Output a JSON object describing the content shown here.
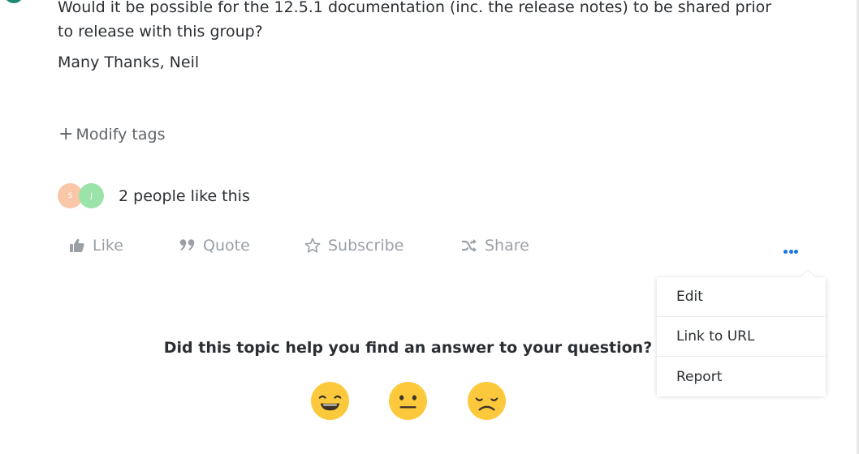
{
  "post": {
    "body_text": "Would it be possible for the 12.5.1 documentation (inc. the release notes) to be shared prior to release with this group?",
    "signoff": "Many Thanks, Neil"
  },
  "tags": {
    "modify_label": "Modify tags"
  },
  "likes": {
    "avatars": [
      {
        "initial": "S",
        "color": "#f8c7a8"
      },
      {
        "initial": "J",
        "color": "#9be3a9"
      }
    ],
    "summary": "2 people like this"
  },
  "actions": {
    "like": "Like",
    "quote": "Quote",
    "subscribe": "Subscribe",
    "share": "Share"
  },
  "more_menu": {
    "items": [
      "Edit",
      "Link to URL",
      "Report"
    ]
  },
  "feedback": {
    "question": "Did this topic help you find an answer to your question?",
    "options": [
      "happy-face-icon",
      "neutral-face-icon",
      "sad-face-icon"
    ]
  },
  "colors": {
    "accent": "#1a73e8",
    "muted_action": "#9aa0a6",
    "emoji": "#fcc93c",
    "text": "#2b2f33"
  }
}
